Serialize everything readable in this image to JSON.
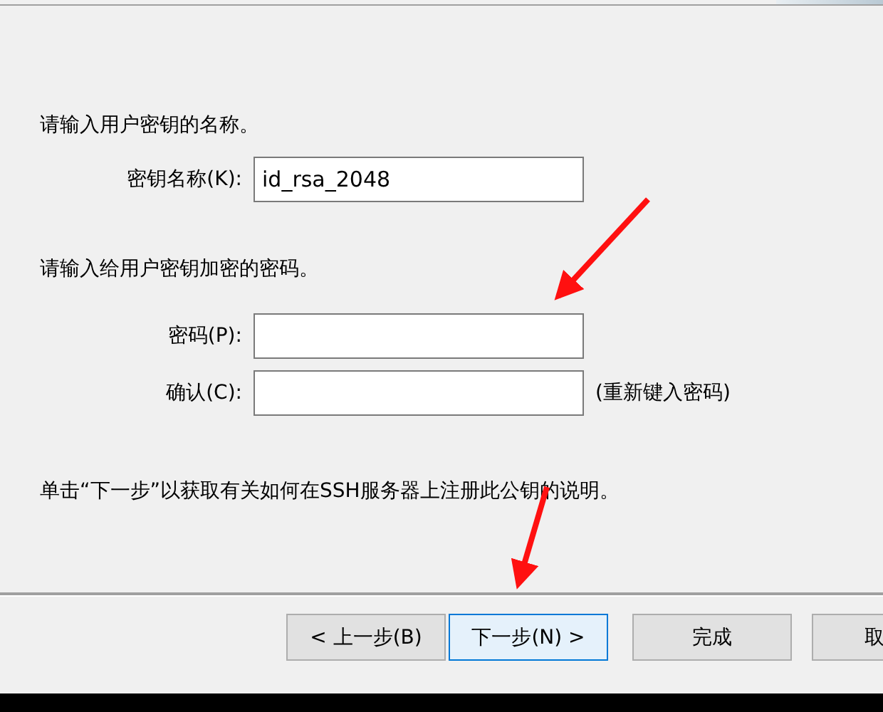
{
  "prompt_name": "请输入用户密钥的名称。",
  "key_name": {
    "label": "密钥名称(K):",
    "value": "id_rsa_2048"
  },
  "prompt_password": "请输入给用户密钥加密的密码。",
  "password": {
    "label": "密码(P):"
  },
  "confirm": {
    "label": "确认(C):",
    "hint": "(重新键入密码)"
  },
  "instruction": "单击“下一步”以获取有关如何在SSH服务器上注册此公钥的说明。",
  "buttons": [
    {
      "label": "< 上一步(B)",
      "selected": false
    },
    {
      "label": "下一步(N) >",
      "selected": true
    },
    {
      "label": "完成",
      "selected": false
    },
    {
      "label": "取",
      "selected": false
    }
  ]
}
